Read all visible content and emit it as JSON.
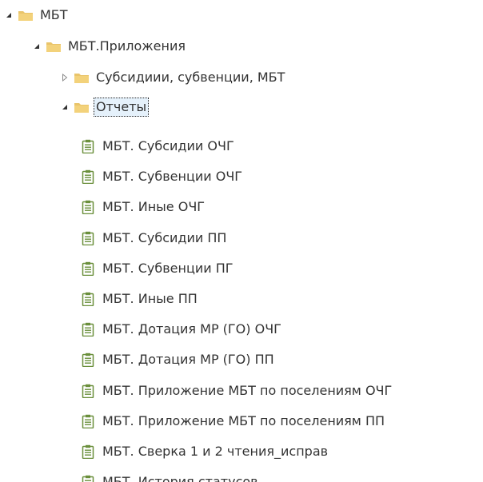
{
  "tree": {
    "root": {
      "label": "МБТ",
      "expanded": true
    },
    "apps": {
      "label": "МБТ.Приложения",
      "expanded": true
    },
    "subsidies": {
      "label": "Субсидиии, субвенции, МБТ",
      "expanded": false
    },
    "reports": {
      "label": "Отчеты",
      "expanded": true,
      "selected": true
    },
    "report_items": [
      "МБТ. Субсидии ОЧГ",
      "МБТ. Субвенции ОЧГ",
      "МБТ. Иные ОЧГ",
      "МБТ. Субсидии ПП",
      "МБТ. Субвенции ПГ",
      "МБТ. Иные ПП",
      "МБТ. Дотация МР (ГО) ОЧГ",
      "МБТ. Дотация МР (ГО) ПП",
      "МБТ. Приложение МБТ по поселениям ОЧГ",
      "МБТ. Приложение МБТ по поселениям ПП",
      "МБТ. Сверка 1 и 2 чтения_исправ",
      "МБТ. История статусов"
    ]
  },
  "colors": {
    "folder": "#e9c46a",
    "folder_dark": "#d4a73a",
    "report_green": "#6a8f3b",
    "selection_bg": "#e5f1fb"
  },
  "icons": {
    "expanded_toggle": "triangle-down-right-icon",
    "collapsed_toggle": "triangle-right-icon",
    "folder": "folder-icon",
    "report": "report-icon"
  }
}
